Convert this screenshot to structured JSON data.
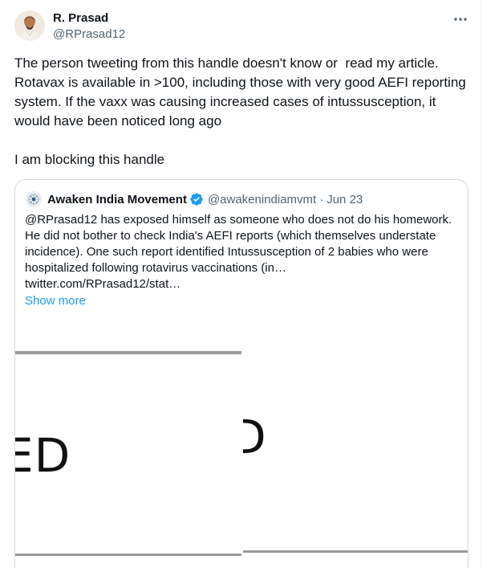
{
  "author": {
    "name": "R. Prasad",
    "handle": "@RPrasad12",
    "avatar_icon": "profile-photo"
  },
  "tweet": {
    "text": "The person tweeting from this handle doesn't know or  read my article. Rotavax is available in >100, including those with very good AEFI reporting system. If the vaxx was causing increased cases of intussusception, it would have been noticed long ago\n\nI am blocking this handle"
  },
  "quoted": {
    "name": "Awaken India Movement",
    "verified": true,
    "handle": "@awakenindiamvmt",
    "separator": "·",
    "date": "Jun 23",
    "text": "@RPrasad12 has exposed himself as someone who does not do his homework. He did not bother to check India's AEFI reports (which themselves understate incidence). One such report identified Intussusception of 2 babies who were hospitalized following rotavirus vaccinations (in…\ntwitter.com/RPrasad12/stat…",
    "show_more": "Show more",
    "media": {
      "left_word": "ED",
      "right_word": "D"
    }
  },
  "colors": {
    "text": "#0f1419",
    "secondary": "#536471",
    "link": "#1d9bf0",
    "border": "#cfd9de"
  }
}
